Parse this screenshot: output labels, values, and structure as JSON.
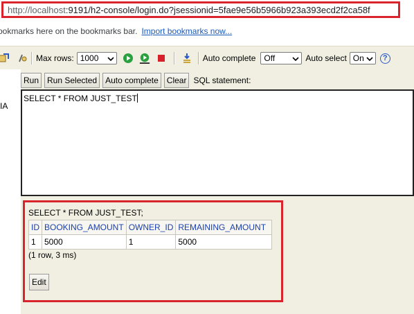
{
  "url": {
    "host_part": "http://localhost",
    "rest_part": ":9191/h2-console/login.do?jsessionid=5fae9e56b5966b923a393ecd2f2ca58f"
  },
  "bookmarks": {
    "prefix_text": "ookmarks here on the bookmarks bar.",
    "import_link": "Import bookmarks now..."
  },
  "toolbar": {
    "max_rows_label": "Max rows:",
    "max_rows_value": "1000",
    "auto_complete_label": "Auto complete",
    "auto_complete_value": "Off",
    "auto_select_label": "Auto select",
    "auto_select_value": "On",
    "help_text": "?"
  },
  "left": {
    "label": "IA"
  },
  "editor_panel": {
    "run_label": "Run",
    "run_selected_label": "Run Selected",
    "auto_complete_label": "Auto complete",
    "clear_label": "Clear",
    "sql_statement_label": "SQL statement:",
    "sql_text": "SELECT * FROM JUST_TEST"
  },
  "result": {
    "statement": "SELECT * FROM JUST_TEST;",
    "columns": [
      "ID",
      "BOOKING_AMOUNT",
      "OWNER_ID",
      "REMAINING_AMOUNT"
    ],
    "rows": [
      [
        "1",
        "5000",
        "1",
        "5000"
      ]
    ],
    "row_info": "(1 row, 3 ms)",
    "edit_label": "Edit"
  },
  "colors": {
    "highlight_border": "#d9232d",
    "panel_bg": "#f1efe2",
    "header_text": "#1a3fae",
    "link": "#1a5ab8"
  }
}
